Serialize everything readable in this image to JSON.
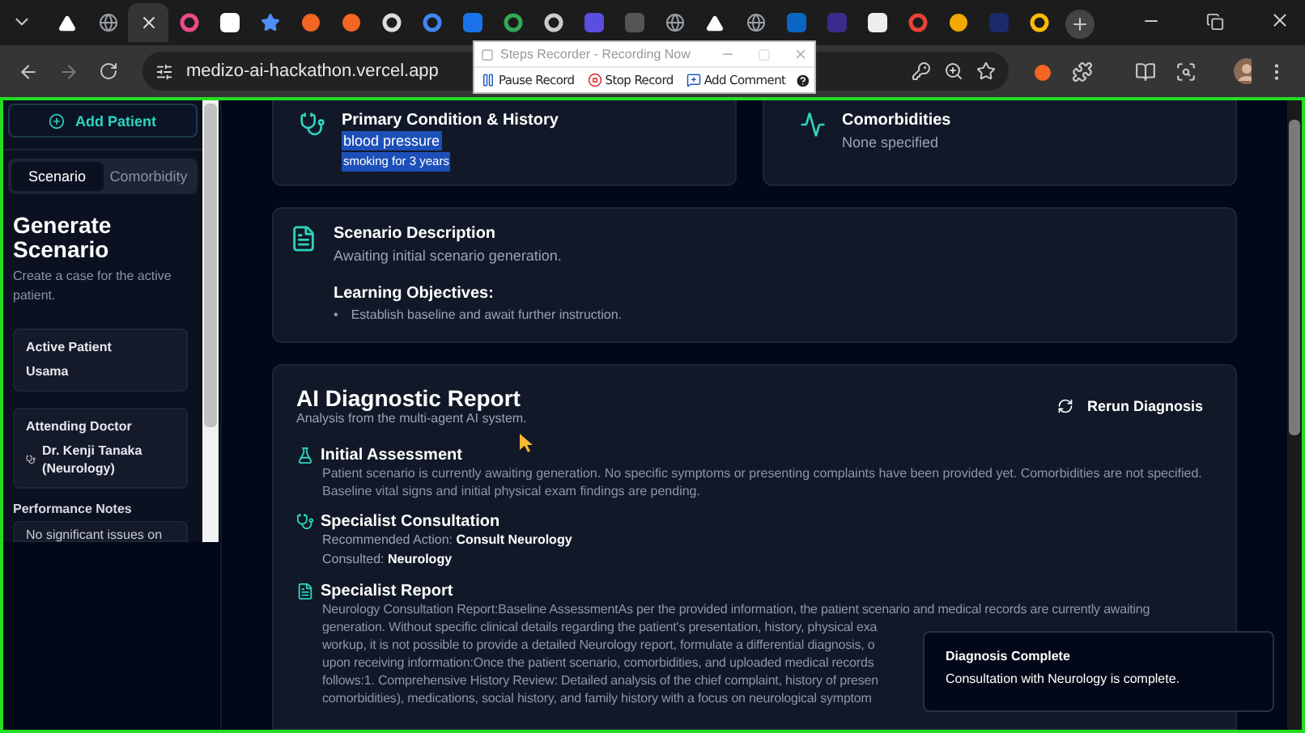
{
  "browser": {
    "tabs": [
      {
        "selected": false
      },
      {
        "selected": false
      },
      {
        "selected": true
      },
      {
        "selected": false
      },
      {
        "selected": false
      },
      {
        "selected": false
      },
      {
        "selected": false
      },
      {
        "selected": false
      },
      {
        "selected": false
      },
      {
        "selected": false
      },
      {
        "selected": false
      },
      {
        "selected": false
      },
      {
        "selected": false
      },
      {
        "selected": false
      },
      {
        "selected": false
      },
      {
        "selected": false
      },
      {
        "selected": false
      },
      {
        "selected": false
      },
      {
        "selected": false
      },
      {
        "selected": false
      },
      {
        "selected": false
      },
      {
        "selected": false
      },
      {
        "selected": false
      },
      {
        "selected": false
      },
      {
        "selected": false
      }
    ],
    "url": "medizo-ai-hackathon.vercel.app"
  },
  "recorder": {
    "title": "Steps Recorder - Recording Now",
    "buttons": [
      {
        "label": "Pause Record",
        "kind": "pause"
      },
      {
        "label": "Stop Record",
        "kind": "stop"
      },
      {
        "label": "Add Comment",
        "kind": "comment"
      }
    ]
  },
  "sidebar": {
    "add_button": "Add Patient",
    "tabs": [
      {
        "label": "Scenario",
        "selected": true
      },
      {
        "label": "Comorbidity",
        "selected": false
      }
    ],
    "heading": "Generate Scenario",
    "subtitle": "Create a case for the active patient.",
    "active_patient": {
      "label": "Active Patient",
      "value": "Usama"
    },
    "doctor": {
      "label": "Attending Doctor",
      "value": "Dr. Kenji Tanaka (Neurology)"
    },
    "notes": {
      "label": "Performance Notes",
      "value": "No significant issues on"
    }
  },
  "condition": {
    "title": "Primary Condition & History",
    "items": [
      {
        "text": "blood pressure",
        "highlighted": true
      },
      {
        "text": "smoking for 3 years",
        "highlighted": true
      }
    ]
  },
  "comorbidities": {
    "title": "Comorbidities",
    "value": "None specified"
  },
  "scenario": {
    "title": "Scenario Description",
    "text": "Awaiting initial scenario generation.",
    "objectives_title": "Learning Objectives:",
    "objectives": [
      {
        "marker": "•",
        "text": "Establish baseline and await further instruction."
      }
    ]
  },
  "report": {
    "title": "AI Diagnostic Report",
    "subtitle": "Analysis from the multi-agent AI system.",
    "rerun": "Rerun Diagnosis",
    "sections": [
      {
        "kind": "assessment",
        "title": "Initial Assessment",
        "text": "Patient scenario is currently awaiting generation. No specific symptoms or presenting complaints have been provided yet. Comorbidities are not specified. Baseline vital signs and initial physical exam findings are pending."
      },
      {
        "kind": "consultation",
        "title": "Specialist Consultation",
        "fields": [
          "Recommended Action: **Consult Neurology**",
          "Consulted: **Neurology**"
        ]
      },
      {
        "kind": "report",
        "title": "Specialist Report",
        "lines": [
          "Neurology Consultation Report:Baseline AssessmentAs per the provided information, the patient scenario and medical records are currently awaiting",
          "generation. Without specific clinical details regarding the patient's presentation, history, physical exa",
          "workup, it is not possible to provide a detailed Neurology report, formulate a differential diagnosis, o",
          "upon receiving information:Once the patient scenario, comorbidities, and uploaded medical records",
          "follows:1. Comprehensive History Review: Detailed analysis of the chief complaint, history of presen",
          "comorbidities), medications, social history, and family history with a focus on neurological symptom"
        ]
      }
    ]
  },
  "toast": {
    "title": "Diagnosis Complete",
    "message": "Consultation with Neurology is complete."
  }
}
